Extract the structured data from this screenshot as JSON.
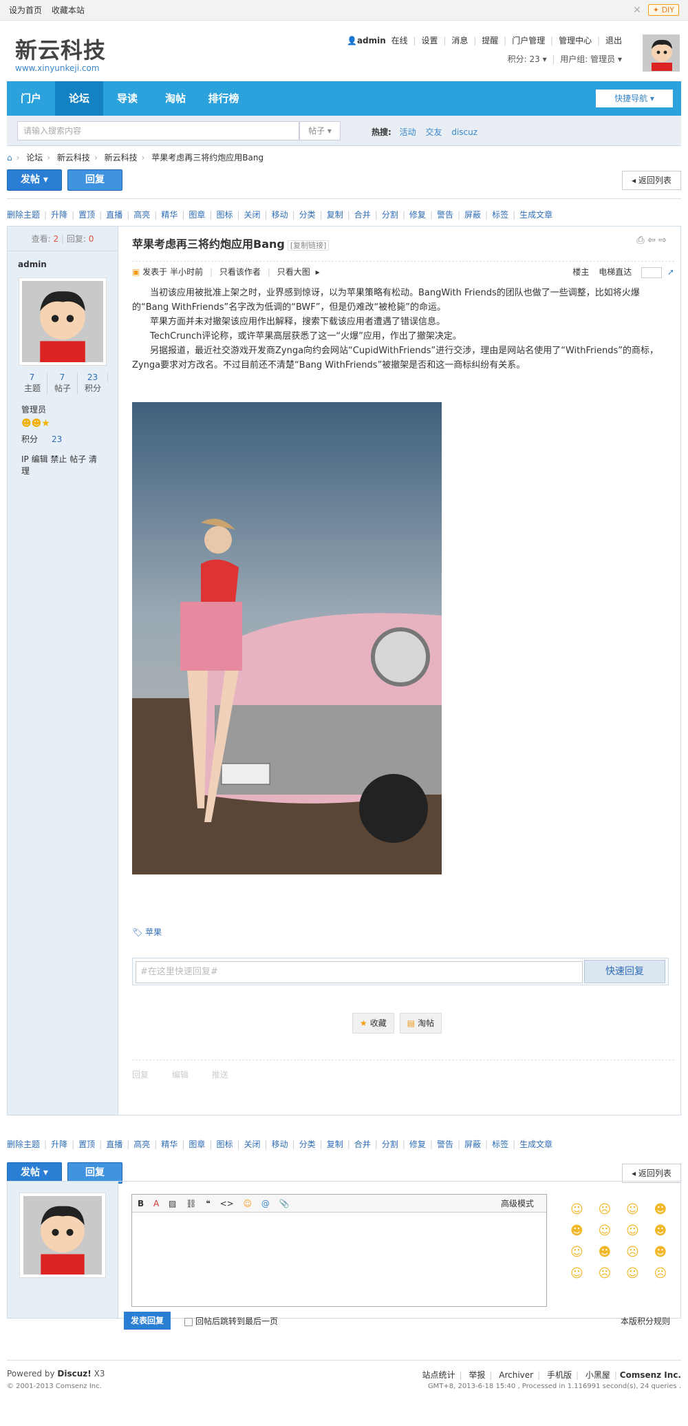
{
  "topbar": {
    "set_home": "设为首页",
    "bookmark": "收藏本站",
    "diy": "DIY"
  },
  "logo": {
    "cn": "新云科技",
    "en": "www.xinyunkeji.com"
  },
  "user": {
    "name": "admin",
    "online": "在线",
    "links": [
      "设置",
      "消息",
      "提醒",
      "门户管理",
      "管理中心",
      "退出"
    ],
    "points": "积分: 23",
    "group": "用户组: 管理员"
  },
  "nav": {
    "items": [
      "门户",
      "论坛",
      "导读",
      "淘帖",
      "排行榜"
    ],
    "quick": "快捷导航"
  },
  "search": {
    "placeholder": "请输入搜索内容",
    "type": "帖子",
    "hot_label": "热搜:",
    "hot": [
      "活动",
      "交友",
      "discuz"
    ]
  },
  "breadcrumb": [
    "论坛",
    "新云科技",
    "新云科技",
    "苹果考虑再三将约炮应用Bang"
  ],
  "buttons": {
    "post": "发帖",
    "reply": "回复",
    "back": "返回列表",
    "fast_reply": "快速回复",
    "submit": "发表回复",
    "fav": "收藏",
    "taotie": "淘帖"
  },
  "mod_actions": [
    "删除主题",
    "升降",
    "置顶",
    "直播",
    "高亮",
    "精华",
    "图章",
    "图标",
    "关闭",
    "移动",
    "分类",
    "复制",
    "合并",
    "分割",
    "修复",
    "警告",
    "屏蔽",
    "标签",
    "生成文章"
  ],
  "thread": {
    "views_label": "查看:",
    "views": "2",
    "replies_label": "回复:",
    "replies": "0",
    "title": "苹果考虑再三将约炮应用Bang",
    "copy_link": "[复制链接]"
  },
  "author": {
    "name": "admin",
    "threads": "7",
    "threads_label": "主题",
    "posts": "7",
    "posts_label": "帖子",
    "credits": "23",
    "credits_label": "积分",
    "group": "管理员",
    "points_label": "积分",
    "points": "23",
    "ops": "IP 编辑 禁止 帖子 清理"
  },
  "meta": {
    "posted": "发表于 半小时前",
    "only_author": "只看该作者",
    "big_img": "只看大图",
    "floor": "楼主",
    "elevator": "电梯直达"
  },
  "body": [
    "当初该应用被批准上架之时，业界感到惊讶，以为苹果策略有松动。BangWith Friends的团队也做了一些调整，比如将火爆的“Bang WithFriends”名字改为低调的“BWF”，但是仍难改“被枪毙”的命运。",
    "苹果方面并未对撤架该应用作出解释，搜索下载该应用者遭遇了错误信息。",
    "TechCrunch评论称，或许苹果高层获悉了这一“火爆”应用，作出了撤架决定。",
    "另据报道，最近社交游戏开发商Zynga向约会网站“CupidWithFriends”进行交涉，理由是网站名使用了“WithFriends”的商标，Zynga要求对方改名。不过目前还不清楚“Bang WithFriends”被撤架是否和这一商标纠纷有关系。"
  ],
  "tag": "苹果",
  "fast_reply_placeholder": "#在这里快速回复#",
  "post_footer": [
    "回复",
    "编辑",
    "推送"
  ],
  "editor": {
    "advanced": "高级模式",
    "jump": "回帖后跳转到最后一页",
    "rule": "本版积分规则"
  },
  "footer": {
    "powered": "Powered by",
    "product": "Discuz!",
    "version": "X3",
    "copyright": "© 2001-2013 Comsenz Inc.",
    "links": [
      "站点统计",
      "举报",
      "Archiver",
      "手机版",
      "小黑屋"
    ],
    "company": "Comsenz Inc.",
    "stats": "GMT+8, 2013-6-18 15:40 , Processed in 1.116991 second(s), 24 queries ."
  }
}
